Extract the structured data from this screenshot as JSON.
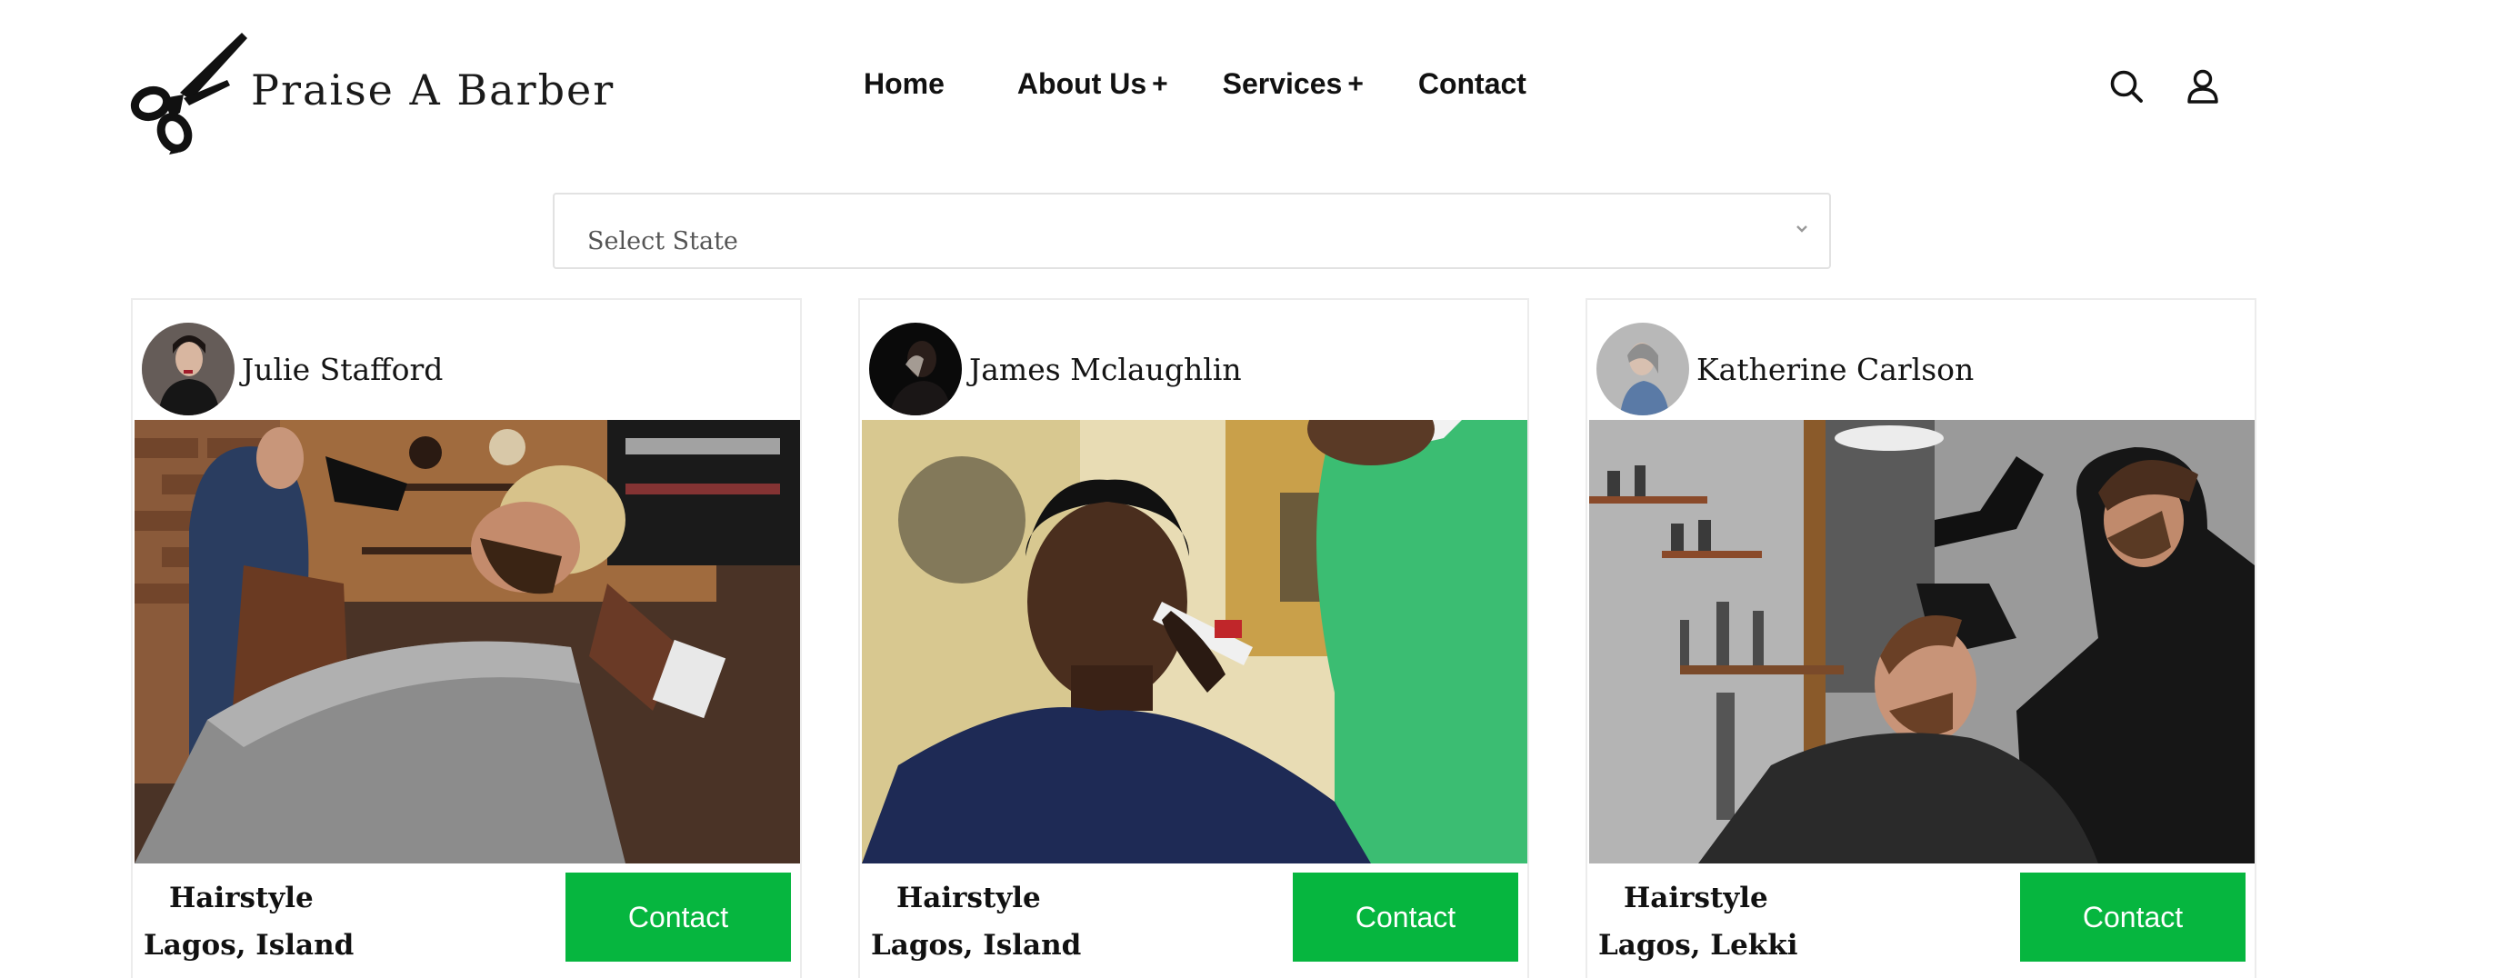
{
  "header": {
    "brand": "Praise A Barber",
    "logo_icon": "scissors-icon",
    "nav": [
      {
        "label": "Home",
        "has_submenu": false
      },
      {
        "label": "About Us",
        "has_submenu": true
      },
      {
        "label": "Services",
        "has_submenu": true
      },
      {
        "label": "Contact",
        "has_submenu": false
      }
    ],
    "submenu_indicator": "+",
    "actions": [
      {
        "icon": "search-icon"
      },
      {
        "icon": "user-icon"
      }
    ]
  },
  "filter": {
    "state_select_label": "Select State",
    "chevron_icon": "chevron-down-icon"
  },
  "barbers": [
    {
      "name": "Julie Stafford",
      "service": "Hairstyle",
      "location": "Lagos, Island",
      "contact_label": "Contact"
    },
    {
      "name": "James Mclaughlin",
      "service": "Hairstyle",
      "location": "Lagos, Island",
      "contact_label": "Contact"
    },
    {
      "name": "Katherine Carlson",
      "service": "Hairstyle",
      "location": "Lagos, Lekki",
      "contact_label": "Contact"
    }
  ],
  "colors": {
    "accent_green": "#06b63f",
    "text": "#111111",
    "border": "#e2e2e2"
  }
}
